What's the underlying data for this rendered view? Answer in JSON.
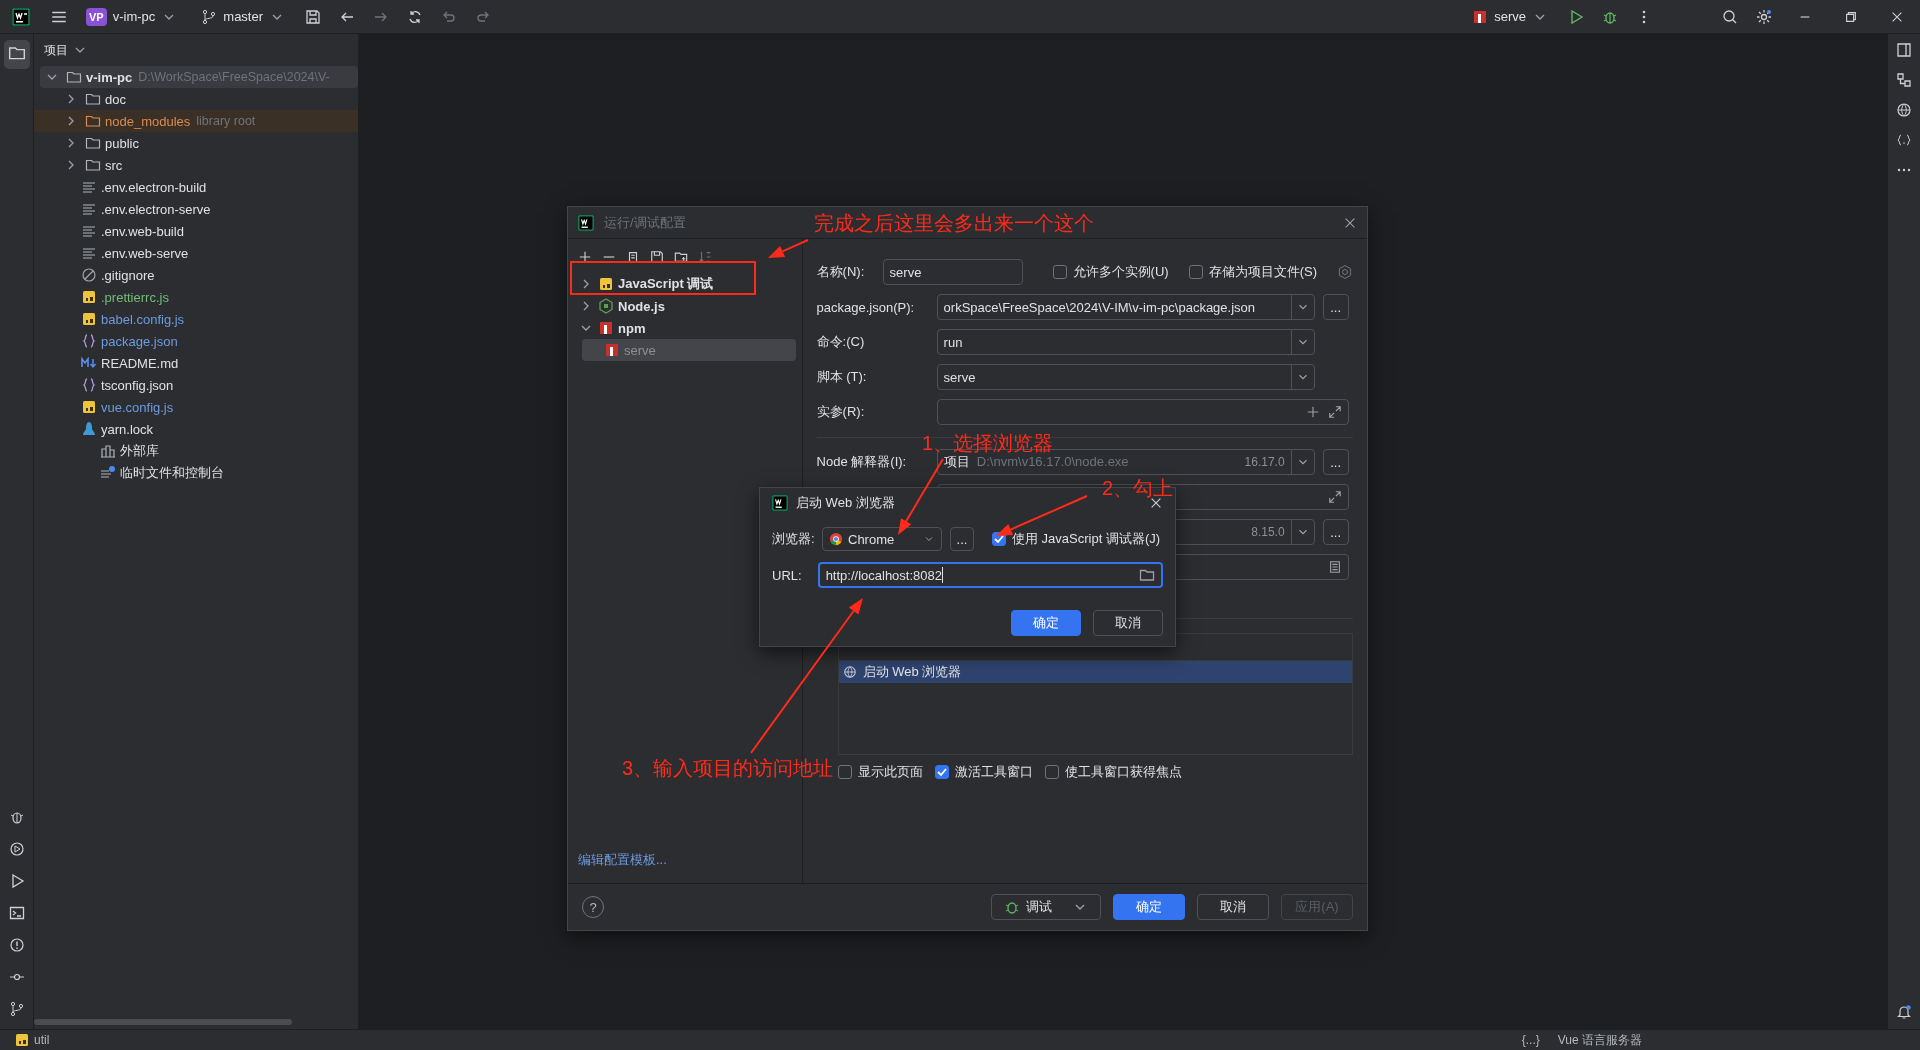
{
  "title_bar": {
    "project_badge": "VP",
    "project": "v-im-pc",
    "branch": "master",
    "run_config": "serve"
  },
  "project_panel": {
    "title": "项目",
    "tree": [
      {
        "name": "v-im-pc",
        "hint": "D:\\WorkSpace\\FreeSpace\\2024\\V-",
        "kind": "root",
        "expanded": true,
        "selected": true,
        "children": [
          {
            "name": "doc",
            "kind": "folder",
            "expanded": false,
            "selected": false
          },
          {
            "name": "node_modules",
            "hint": "library root",
            "kind": "library",
            "expanded": false,
            "selected": false
          },
          {
            "name": "public",
            "kind": "folder",
            "expanded": false,
            "selected": false
          },
          {
            "name": "src",
            "kind": "folder",
            "expanded": false,
            "selected": false
          },
          {
            "name": ".env.electron-build",
            "kind": "text",
            "selected": false
          },
          {
            "name": ".env.electron-serve",
            "kind": "text",
            "selected": false
          },
          {
            "name": ".env.web-build",
            "kind": "text",
            "selected": false
          },
          {
            "name": ".env.web-serve",
            "kind": "text",
            "selected": false
          },
          {
            "name": ".gitignore",
            "kind": "ignore",
            "selected": false
          },
          {
            "name": ".prettierrc.js",
            "kind": "js",
            "color": "#73bd79",
            "selected": false
          },
          {
            "name": "babel.config.js",
            "kind": "js",
            "color": "#6c9bdf",
            "selected": false
          },
          {
            "name": "package.json",
            "kind": "json",
            "color": "#6c9bdf",
            "selected": false
          },
          {
            "name": "README.md",
            "kind": "md",
            "selected": false
          },
          {
            "name": "tsconfig.json",
            "kind": "json",
            "selected": false
          },
          {
            "name": "vue.config.js",
            "kind": "js",
            "color": "#6c9bdf",
            "selected": false
          },
          {
            "name": "yarn.lock",
            "kind": "yarn",
            "selected": false
          }
        ]
      }
    ],
    "extras": [
      {
        "name": "外部库",
        "kind": "libraries"
      },
      {
        "name": "临时文件和控制台",
        "kind": "scratch"
      }
    ]
  },
  "status_bar": {
    "module": "util",
    "items": [
      "{...}",
      "Vue 语言服务器"
    ]
  },
  "dialog": {
    "title": "运行/调试配置",
    "tree": [
      {
        "name": "JavaScript 调试",
        "kind": "js",
        "expanded": false,
        "selected": false
      },
      {
        "name": "Node.js",
        "kind": "node",
        "expanded": false,
        "selected": false
      },
      {
        "name": "npm",
        "kind": "npm",
        "expanded": true,
        "selected": false,
        "children": [
          {
            "name": "serve",
            "kind": "npm",
            "selected": true
          }
        ]
      }
    ],
    "template_link": "编辑配置模板...",
    "help": "?",
    "name": {
      "label": "名称(N):",
      "value": "serve"
    },
    "options": [
      {
        "label": "允许多个实例(U)",
        "checked": false
      },
      {
        "label": "存储为项目文件(S)",
        "checked": false
      }
    ],
    "fields": [
      {
        "kind": "dropdown",
        "label": "package.json(P):",
        "value": "orkSpace\\FreeSpace\\2024\\V-IM\\v-im-pc\\package.json",
        "more": "..."
      },
      {
        "kind": "select",
        "label": "命令:(C)",
        "value": "run"
      },
      {
        "kind": "dropdown",
        "label": "脚本 (T):",
        "value": "serve"
      },
      {
        "kind": "args",
        "label": "实参(R):"
      }
    ],
    "interpreter": {
      "label": "Node 解释器(I):",
      "prefix": "项目",
      "value": "D:\\nvm\\v16.17.0\\node.exe",
      "version": "16.17.0",
      "more": "..."
    },
    "covered_fields": [
      {
        "kind": "expand"
      },
      {
        "kind": "version",
        "version": "8.15.0",
        "more": "..."
      },
      {
        "kind": "env"
      }
    ],
    "before_launch": [
      {
        "label": "启动 Web 浏览器",
        "selected": true
      }
    ],
    "launch_options": [
      {
        "label": "显示此页面",
        "checked": false
      },
      {
        "label": "激活工具窗口",
        "checked": true
      },
      {
        "label": "使工具窗口获得焦点",
        "checked": false
      }
    ],
    "buttons": [
      {
        "kind": "run",
        "label": "调试",
        "disabled": false
      },
      {
        "kind": "primary",
        "label": "确定",
        "disabled": false
      },
      {
        "kind": "plain",
        "label": "取消",
        "disabled": false
      },
      {
        "kind": "plain",
        "label": "应用(A)",
        "disabled": true
      }
    ]
  },
  "browser_dialog": {
    "title": "启动 Web 浏览器",
    "browser_label": "浏览器:",
    "browser": "Chrome",
    "more": "...",
    "debugger": {
      "label": "使用 JavaScript 调试器(J)",
      "checked": true
    },
    "url_label": "URL:",
    "url": "http://localhost:8082",
    "buttons": [
      {
        "kind": "primary",
        "label": "确定"
      },
      {
        "kind": "plain",
        "label": "取消"
      }
    ]
  },
  "annotations": [
    {
      "text": "完成之后这里会多出来一个这个"
    },
    {
      "text": "1、选择浏览器"
    },
    {
      "text": "2、勾上"
    },
    {
      "text": "3、输入项目的访问地址"
    }
  ]
}
